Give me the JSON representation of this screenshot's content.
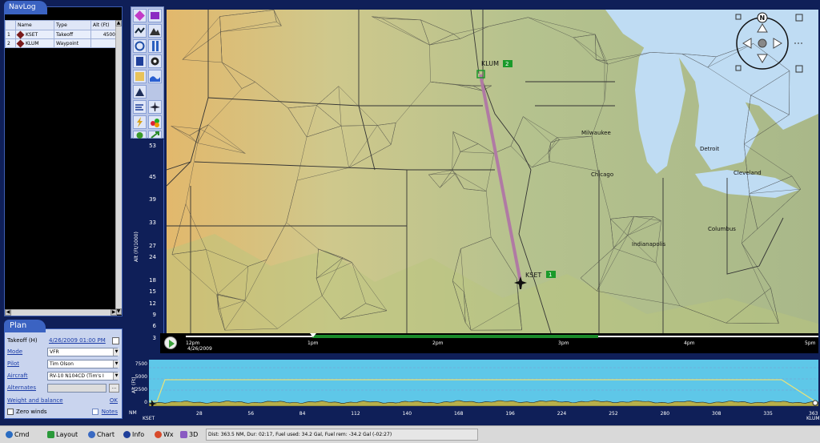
{
  "navlog": {
    "title": "NavLog",
    "columns": [
      "Name",
      "Type",
      "Alt (Ft)"
    ],
    "rows": [
      {
        "num": "1",
        "name": "KSET",
        "type": "Takeoff",
        "alt": "4500"
      },
      {
        "num": "2",
        "name": "KLUM",
        "type": "Waypoint",
        "alt": ""
      }
    ]
  },
  "plan": {
    "title": "Plan",
    "takeoff_label": "Takeoff (H)",
    "takeoff_value": "4/26/2009 01:00 PM",
    "mode_label": "Mode",
    "mode_value": "VFR",
    "pilot_label": "Pilot",
    "pilot_value": "Tim Olson",
    "aircraft_label": "Aircraft",
    "aircraft_value": "RV-10 N104CD (Tim's I",
    "alternates_label": "Alternates",
    "weight_label": "Weight and balance",
    "ok_label": "OK",
    "zero_winds_label": "Zero winds",
    "notes_label": "Notes"
  },
  "alt_axis": {
    "label": "Alt (Ft/1000)",
    "ticks": [
      "53",
      "45",
      "39",
      "33",
      "27",
      "24",
      "18",
      "15",
      "12",
      "9",
      "6",
      "3"
    ]
  },
  "map": {
    "cities": [
      "Milwaukee",
      "Chicago",
      "Detroit",
      "Cleveland",
      "Indianapolis",
      "Columbus"
    ],
    "waypoints": [
      {
        "name": "KLUM",
        "badge": "2"
      },
      {
        "name": "KSET",
        "badge": "1"
      }
    ],
    "compass_label": "N"
  },
  "timeline": {
    "labels": [
      "12pm",
      "1pm",
      "2pm",
      "3pm",
      "4pm",
      "5pm"
    ],
    "date": "4/26/2009"
  },
  "profile": {
    "y_ticks": [
      "7500",
      "5000",
      "2500",
      "0"
    ],
    "y_label": "Alt (Ft)",
    "x_unit": "NM",
    "x_ticks": [
      "28",
      "56",
      "84",
      "112",
      "140",
      "168",
      "196",
      "224",
      "252",
      "280",
      "308",
      "335",
      "363"
    ],
    "start_label": "KSET",
    "end_label": "KLUM"
  },
  "bottombar": {
    "buttons": [
      {
        "label": "Cmd",
        "icon": "cmd-icon"
      },
      {
        "label": "Layout",
        "icon": "layout-icon"
      },
      {
        "label": "Chart",
        "icon": "chart-icon"
      },
      {
        "label": "Info",
        "icon": "info-icon"
      },
      {
        "label": "Wx",
        "icon": "weather-icon"
      },
      {
        "label": "3D",
        "icon": "3d-icon"
      }
    ],
    "status": "Dist: 363.5 NM, Dur: 02:17, Fuel used: 34.2 Gal, Fuel rem: -34.2 Gal (-02:27)"
  },
  "colors": {
    "panel_blue": "#3b63c2",
    "route": "#b07aa4",
    "waypoint_green": "#1a9a2a",
    "profile_sky": "#5ec7e8",
    "timeline_green": "#1a8a2a"
  }
}
